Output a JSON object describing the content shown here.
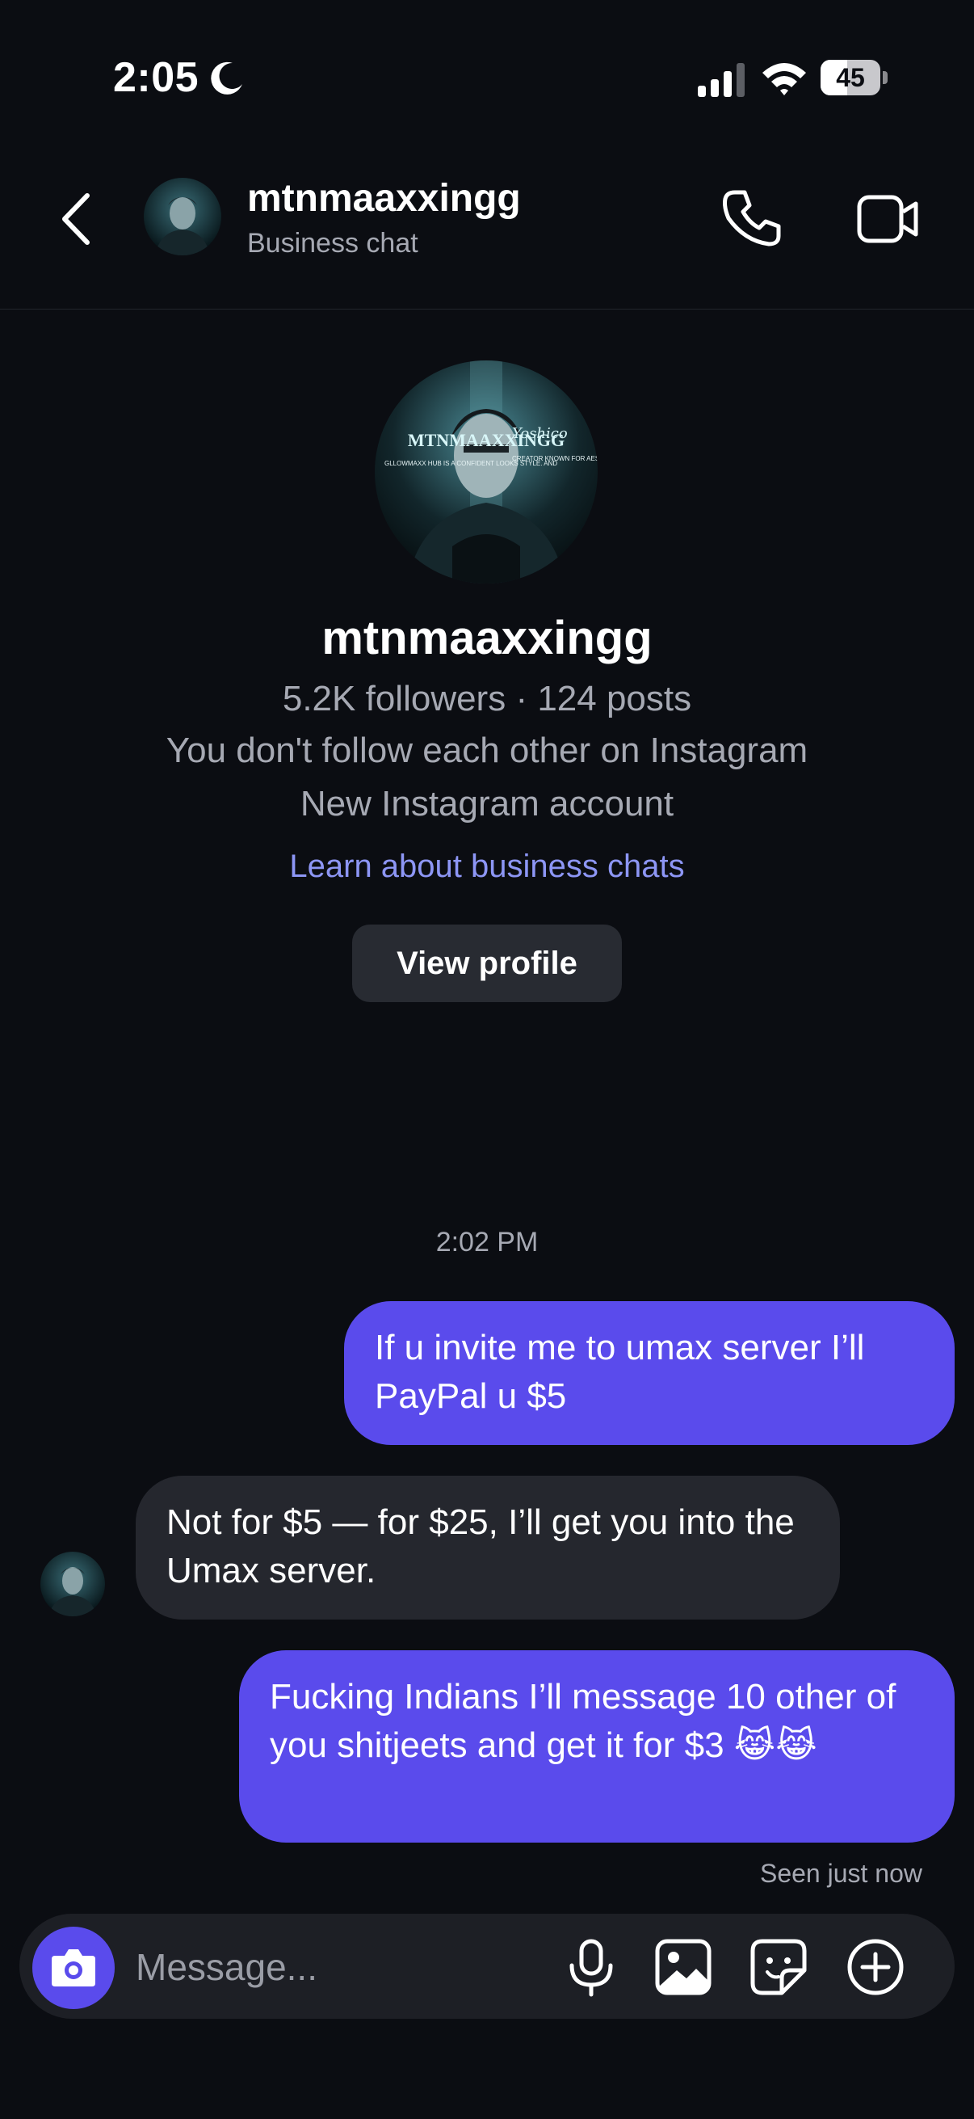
{
  "status_bar": {
    "time": "2:05",
    "battery": "45",
    "battery_level": 0.45
  },
  "header": {
    "username": "mtnmaaxxingg",
    "subtitle": "Business chat"
  },
  "profile": {
    "username": "mtnmaaxxingg",
    "stats": "5.2K followers · 124 posts",
    "follow_status": "You don't follow each other on Instagram",
    "account_note": "New Instagram account",
    "learn_link": "Learn about business chats",
    "view_profile_label": "View profile",
    "avatar_text": {
      "title": "MTNMAAXXINGG",
      "script": "Yoshico",
      "left_lines": "GLLOWMAXX HUB IS A CONFIDENT LOOKS STYLE. AND",
      "right_lines": "CREATOR KNOWN FOR AESTHETIC REELS, SHARP BRANDING."
    }
  },
  "conversation": {
    "timestamp": "2:02 PM",
    "messages": [
      {
        "from": "me",
        "text": "If u invite me to umax server I’ll PayPal u $5"
      },
      {
        "from": "them",
        "text": "Not for $5 — for $25, I’ll get you into the Umax server."
      },
      {
        "from": "me",
        "text": "Fucking Indians I’ll message 10 other of you shitjeets and get it for $3 😹😹"
      }
    ],
    "seen": "Seen just now"
  },
  "composer": {
    "placeholder": "Message..."
  },
  "icons": {
    "back": "chevron-left-icon",
    "call": "phone-icon",
    "video": "video-camera-icon",
    "camera": "camera-icon",
    "mic": "microphone-icon",
    "gallery": "image-icon",
    "sticker": "sticker-icon",
    "plus": "plus-circle-icon"
  },
  "colors": {
    "background": "#0b0d12",
    "outgoing_bubble": "#5a4bec",
    "incoming_bubble": "#25272e",
    "link": "#8d96f5",
    "secondary_text": "#a6a9b3"
  }
}
